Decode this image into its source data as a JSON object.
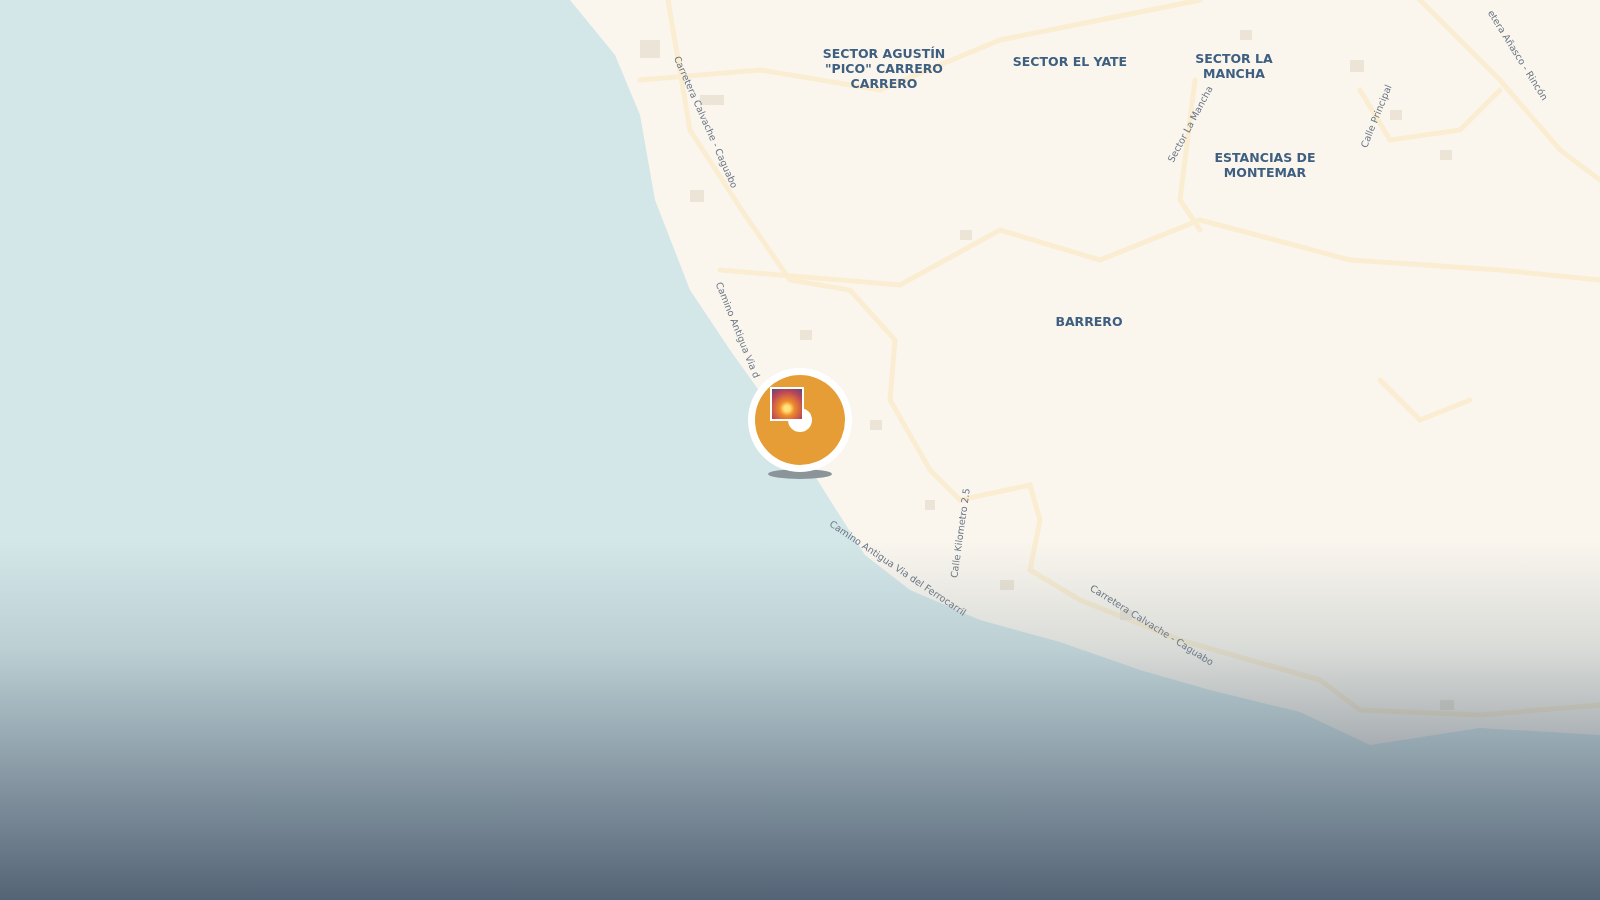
{
  "map": {
    "place_labels": [
      {
        "text": "SECTOR AGUSTÍN \"PICO\" CARRERO CARRERO"
      },
      {
        "text": "SECTOR EL YATE"
      },
      {
        "text": "SECTOR LA MANCHA"
      },
      {
        "text": "ESTANCIAS DE MONTEMAR"
      },
      {
        "text": "BARRERO"
      }
    ],
    "road_labels": [
      {
        "text": "Carretera Calvache - Caguabo"
      },
      {
        "text": "Camino Antigua Via d"
      },
      {
        "text": "Camino Antigua Via del Ferrocarril"
      },
      {
        "text": "Calle Kilometro 2.5"
      },
      {
        "text": "Carretera Calvache - Caguabo"
      },
      {
        "text": "Sector La Mancha"
      },
      {
        "text": "Calle Principal"
      },
      {
        "text": "etera Añasco - Rincón"
      }
    ]
  }
}
